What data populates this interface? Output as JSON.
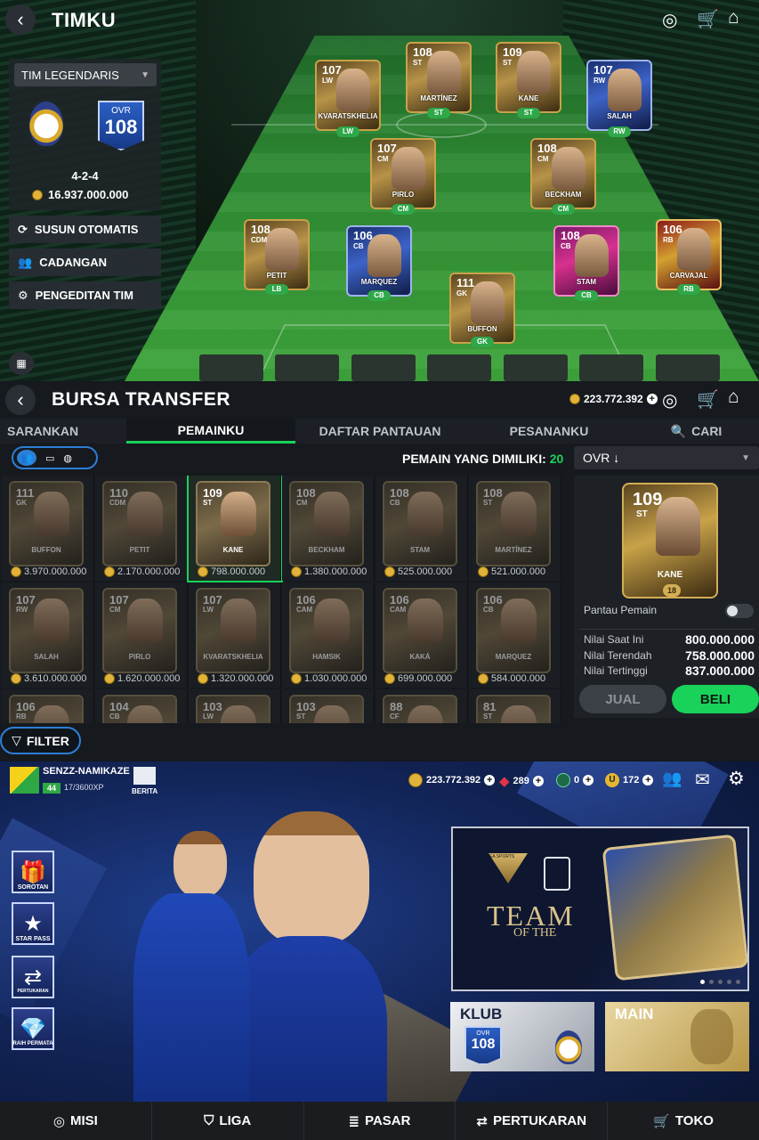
{
  "colors": {
    "accent_green": "#19d25a",
    "gold": "#c9a248",
    "tab_underline": "#19d25a"
  },
  "timku": {
    "title": "TIMKU",
    "team_select": "TIM LEGENDARIS",
    "ovr_label": "OVR",
    "ovr_value": "108",
    "formation": "4-2-4",
    "team_value": "16.937.000.000",
    "buttons": [
      {
        "label": "SUSUN OTOMATIS",
        "icon": "refresh-icon"
      },
      {
        "label": "CADANGAN",
        "icon": "users-icon"
      },
      {
        "label": "PENGEDITAN TIM",
        "icon": "edit-team-icon"
      }
    ],
    "players": [
      {
        "name": "KVARATSKHELIA",
        "ovr": "107",
        "pos": "LW",
        "tag": "LW"
      },
      {
        "name": "MARTÍNEZ",
        "ovr": "108",
        "pos": "ST",
        "tag": "ST"
      },
      {
        "name": "KANE",
        "ovr": "109",
        "pos": "ST",
        "tag": "ST"
      },
      {
        "name": "SALAH",
        "ovr": "107",
        "pos": "RW",
        "tag": "RW"
      },
      {
        "name": "PIRLO",
        "ovr": "107",
        "pos": "CM",
        "tag": "CM"
      },
      {
        "name": "BECKHAM",
        "ovr": "108",
        "pos": "CM",
        "tag": "CM"
      },
      {
        "name": "PETIT",
        "ovr": "108",
        "pos": "CDM",
        "tag": "LB"
      },
      {
        "name": "MARQUEZ",
        "ovr": "106",
        "pos": "CB",
        "tag": "CB"
      },
      {
        "name": "STAM",
        "ovr": "108",
        "pos": "CB",
        "tag": "CB"
      },
      {
        "name": "CARVAJAL",
        "ovr": "106",
        "pos": "RB",
        "tag": "RB"
      },
      {
        "name": "BUFFON",
        "ovr": "111",
        "pos": "GK",
        "tag": "GK"
      }
    ]
  },
  "bursa": {
    "title": "BURSA TRANSFER",
    "coins": "223.772.392",
    "tabs": [
      "SARANKAN",
      "PEMAINKU",
      "DAFTAR PANTAUAN",
      "PESANANKU",
      "CARI"
    ],
    "owned_label": "PEMAIN YANG DIMILIKI:",
    "owned_count": "20",
    "sort": "OVR ↓",
    "grid": [
      {
        "name": "BUFFON",
        "ovr": "111",
        "pos": "GK",
        "price": "3.970.000.000"
      },
      {
        "name": "PETIT",
        "ovr": "110",
        "pos": "CDM",
        "price": "2.170.000.000"
      },
      {
        "name": "KANE",
        "ovr": "109",
        "pos": "ST",
        "price": "798.000.000"
      },
      {
        "name": "BECKHAM",
        "ovr": "108",
        "pos": "CM",
        "price": "1.380.000.000"
      },
      {
        "name": "STAM",
        "ovr": "108",
        "pos": "CB",
        "price": "525.000.000"
      },
      {
        "name": "MARTÍNEZ",
        "ovr": "108",
        "pos": "ST",
        "price": "521.000.000"
      },
      {
        "name": "SALAH",
        "ovr": "107",
        "pos": "RW",
        "price": "3.610.000.000"
      },
      {
        "name": "PIRLO",
        "ovr": "107",
        "pos": "CM",
        "price": "1.620.000.000"
      },
      {
        "name": "KVARATSKHELIA",
        "ovr": "107",
        "pos": "LW",
        "price": "1.320.000.000"
      },
      {
        "name": "HAMSIK",
        "ovr": "106",
        "pos": "CAM",
        "price": "1.030.000.000"
      },
      {
        "name": "KAKÁ",
        "ovr": "106",
        "pos": "CAM",
        "price": "699.000.000"
      },
      {
        "name": "MARQUEZ",
        "ovr": "106",
        "pos": "CB",
        "price": "584.000.000"
      }
    ],
    "partial_row": [
      {
        "ovr": "106",
        "pos": "RB"
      },
      {
        "ovr": "104",
        "pos": "CB"
      },
      {
        "ovr": "103",
        "pos": "LW"
      },
      {
        "ovr": "103",
        "pos": "ST"
      },
      {
        "ovr": "88",
        "pos": "CF"
      },
      {
        "ovr": "81",
        "pos": "ST"
      }
    ],
    "detail": {
      "name": "KANE",
      "ovr": "109",
      "pos": "ST",
      "rank": "18",
      "watch_label": "Pantau Pemain",
      "rows": [
        {
          "label": "Nilai Saat Ini",
          "value": "800.000.000"
        },
        {
          "label": "Nilai Terendah",
          "value": "758.000.000"
        },
        {
          "label": "Nilai Tertinggi",
          "value": "837.000.000"
        }
      ],
      "sell": "JUAL",
      "buy": "BELI"
    },
    "filter": "FILTER"
  },
  "home": {
    "username": "SENZZ-NAMIKAZE",
    "level": "44",
    "xp": "17/3600XP",
    "news": "BERITA",
    "coins": "223.772.392",
    "gems": "289",
    "tokens": "0",
    "ut": "172",
    "left_icons": [
      "SOROTAN",
      "STAR PASS",
      "PERTUKARAN",
      "RAIH PERMATA"
    ],
    "toty": {
      "brand": "EA SPORTS",
      "line1": "TEAM",
      "line2": "OF THE"
    },
    "klub": {
      "label": "KLUB",
      "ovr_label": "OVR",
      "ovr": "108"
    },
    "main_label": "MAIN",
    "nav": [
      {
        "label": "MISI",
        "icon": "target-icon"
      },
      {
        "label": "LIGA",
        "icon": "shield-icon"
      },
      {
        "label": "PASAR",
        "icon": "coins-icon"
      },
      {
        "label": "PERTUKARAN",
        "icon": "swap-icon"
      },
      {
        "label": "TOKO",
        "icon": "cart-icon"
      }
    ]
  }
}
